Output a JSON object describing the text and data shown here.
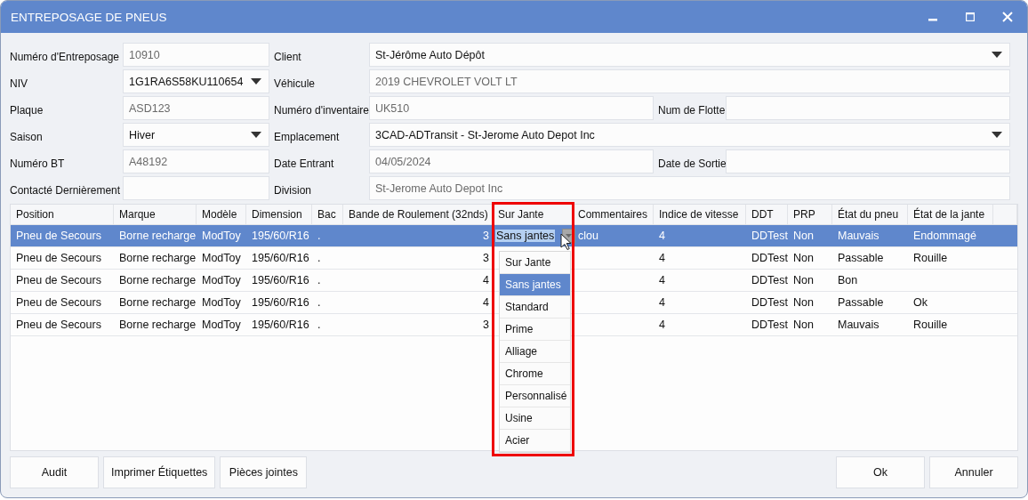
{
  "window": {
    "title": "ENTREPOSAGE DE PNEUS"
  },
  "form": [
    {
      "fields": [
        {
          "label": "Numéro d'Entreposage",
          "value": "10910",
          "kind": "text"
        },
        {
          "label": "Client",
          "value": "St-Jérôme Auto Dépôt",
          "kind": "dropdown"
        }
      ]
    },
    {
      "fields": [
        {
          "label": "NIV",
          "value": "1G1RA6S58KU110654",
          "kind": "dropdown"
        },
        {
          "label": "Véhicule",
          "value": "2019 CHEVROLET VOLT LT",
          "kind": "text"
        }
      ]
    },
    {
      "fields": [
        {
          "label": "Plaque",
          "value": "ASD123",
          "kind": "text"
        },
        {
          "label": "Numéro d'inventaire",
          "value": "UK510",
          "kind": "text"
        },
        {
          "label": "Num de Flotte",
          "kind": "text"
        }
      ]
    },
    {
      "fields": [
        {
          "label": "Saison",
          "value": "Hiver",
          "kind": "dropdown"
        },
        {
          "label": "Emplacement",
          "value": "3CAD-ADTransit - St-Jerome Auto Depot Inc",
          "kind": "dropdown"
        }
      ]
    },
    {
      "fields": [
        {
          "label": "Numéro BT",
          "value": "A48192",
          "kind": "text"
        },
        {
          "label": "Date Entrant",
          "value": "04/05/2024",
          "kind": "text"
        },
        {
          "label": "Date de Sortie",
          "kind": "text"
        }
      ]
    },
    {
      "fields": [
        {
          "label": "Contacté Dernièrement",
          "kind": "text"
        },
        {
          "label": "Division",
          "value": "St-Jerome Auto Depot Inc",
          "kind": "text"
        }
      ]
    }
  ],
  "table": {
    "columns": [
      {
        "label": "Position",
        "kind": "text"
      },
      {
        "label": "Marque",
        "kind": "text"
      },
      {
        "label": "Modèle",
        "kind": "text"
      },
      {
        "label": "Dimension",
        "kind": "text"
      },
      {
        "label": "Bac",
        "kind": "text"
      },
      {
        "label": "Bande de Roulement (32nds)",
        "kind": "number"
      },
      {
        "label": "Sur Jante",
        "kind": "text"
      },
      {
        "label": "Commentaires",
        "kind": "text"
      },
      {
        "label": "Indice de vitesse",
        "kind": "text"
      },
      {
        "label": "DDT",
        "kind": "text"
      },
      {
        "label": "PRP",
        "kind": "text"
      },
      {
        "label": "État du pneu",
        "kind": "text"
      },
      {
        "label": "État de la jante",
        "kind": "text"
      }
    ],
    "rows": [
      {
        "selected": true,
        "cells": [
          "Pneu de Secours",
          "Borne recharge",
          "ModToy",
          "195/60/R16",
          ".",
          "3",
          {
            "kind": "combo",
            "value": "Sans jantes",
            "options": [
              {
                "label": "Sur Jante",
                "selected": false
              },
              {
                "label": "Sans jantes",
                "selected": true
              },
              {
                "label": "Standard",
                "selected": false
              },
              {
                "label": "Prime",
                "selected": false
              },
              {
                "label": "Alliage",
                "selected": false
              },
              {
                "label": "Chrome",
                "selected": false
              },
              {
                "label": "Personnalisé",
                "selected": false
              },
              {
                "label": "Usine",
                "selected": false
              },
              {
                "label": "Acier",
                "selected": false
              }
            ]
          },
          "clou",
          "4",
          "DDTest",
          "Non",
          "Mauvais",
          "Endommagé"
        ]
      },
      {
        "selected": false,
        "cells": [
          "Pneu de Secours",
          "Borne recharge",
          "ModToy",
          "195/60/R16",
          ".",
          "3",
          null,
          null,
          "4",
          "DDTest",
          "Non",
          "Passable",
          "Rouille"
        ]
      },
      {
        "selected": false,
        "cells": [
          "Pneu de Secours",
          "Borne recharge",
          "ModToy",
          "195/60/R16",
          ".",
          "4",
          null,
          null,
          "4",
          "DDTest",
          "Non",
          "Bon",
          null
        ]
      },
      {
        "selected": false,
        "cells": [
          "Pneu de Secours",
          "Borne recharge",
          "ModToy",
          "195/60/R16",
          ".",
          "4",
          null,
          null,
          "4",
          "DDTest",
          "Non",
          "Passable",
          "Ok"
        ]
      },
      {
        "selected": false,
        "cells": [
          "Pneu de Secours",
          "Borne recharge",
          "ModToy",
          "195/60/R16",
          ".",
          "3",
          null,
          null,
          "4",
          "DDTest",
          "Non",
          "Mauvais",
          "Rouille"
        ]
      }
    ]
  },
  "buttons_left": [
    "Audit",
    "Imprimer Étiquettes",
    "Pièces jointes"
  ],
  "buttons_right": [
    "Ok",
    "Annuler"
  ]
}
